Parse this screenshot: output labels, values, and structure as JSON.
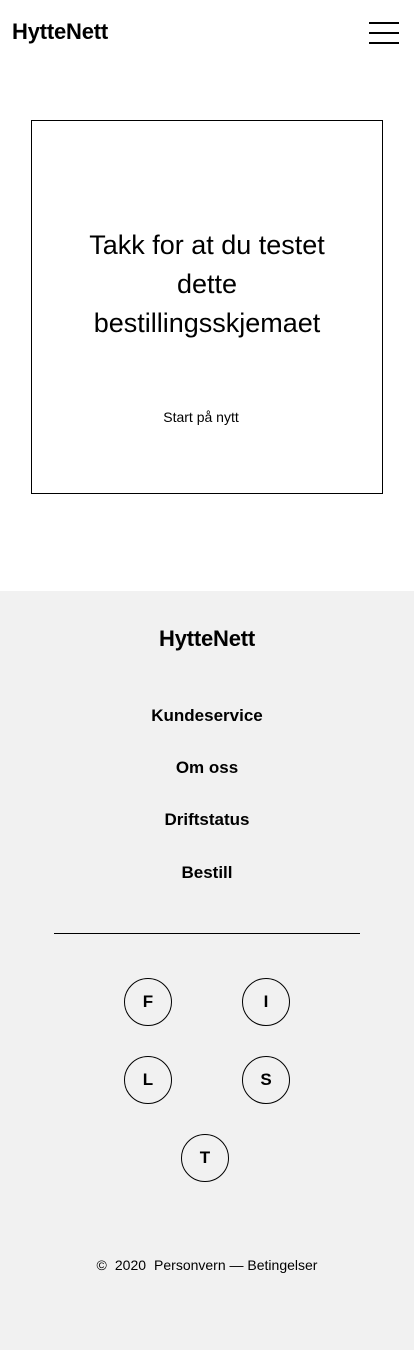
{
  "header": {
    "logo": "HytteNett",
    "menu_icon": "hamburger-menu-icon"
  },
  "card": {
    "title": "Takk for at du testet dette bestillingsskjemaet",
    "restart_label": "Start på nytt"
  },
  "footer": {
    "logo": "HytteNett",
    "links": [
      {
        "label": "Kundeservice"
      },
      {
        "label": "Om oss"
      },
      {
        "label": "Driftstatus"
      },
      {
        "label": "Bestill"
      }
    ],
    "social": [
      {
        "letter": "F",
        "icon": "facebook-icon"
      },
      {
        "letter": "I",
        "icon": "instagram-icon"
      },
      {
        "letter": "L",
        "icon": "linkedin-icon"
      },
      {
        "letter": "S",
        "icon": "snapchat-icon"
      },
      {
        "letter": "T",
        "icon": "twitter-icon"
      }
    ],
    "copyright_symbol": "©",
    "year": "2020",
    "privacy_label": "Personvern",
    "separator": "—",
    "terms_label": "Betingelser"
  }
}
